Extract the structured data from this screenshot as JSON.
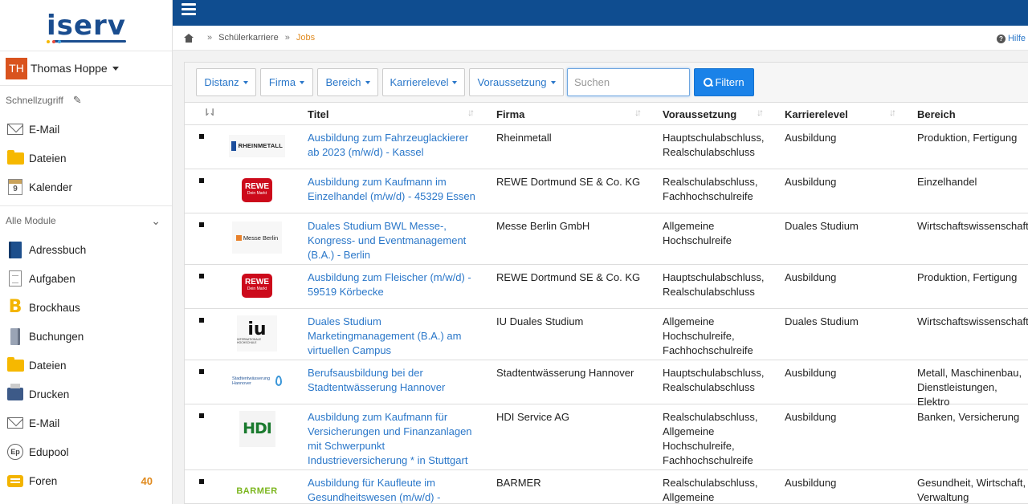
{
  "logo": {
    "text": "iserv"
  },
  "user": {
    "initials": "TH",
    "name": "Thomas Hoppe"
  },
  "sidebar": {
    "quick_access_label": "Schnellzugriff",
    "quick_items": [
      {
        "label": "E-Mail",
        "icon": "mail-icon"
      },
      {
        "label": "Dateien",
        "icon": "folder-icon"
      },
      {
        "label": "Kalender",
        "icon": "calendar-icon",
        "icon_text": "9"
      }
    ],
    "all_modules_label": "Alle Module",
    "modules": [
      {
        "label": "Adressbuch",
        "icon": "addressbook-icon"
      },
      {
        "label": "Aufgaben",
        "icon": "tasks-icon"
      },
      {
        "label": "Brockhaus",
        "icon": "brockhaus-icon",
        "icon_text": "B"
      },
      {
        "label": "Buchungen",
        "icon": "booking-icon"
      },
      {
        "label": "Dateien",
        "icon": "folder-icon"
      },
      {
        "label": "Drucken",
        "icon": "printer-icon"
      },
      {
        "label": "E-Mail",
        "icon": "mail-icon"
      },
      {
        "label": "Edupool",
        "icon": "edupool-icon",
        "icon_text": "Ep"
      },
      {
        "label": "Foren",
        "icon": "forum-icon",
        "badge": "40"
      }
    ]
  },
  "breadcrumb": {
    "items": [
      "Schülerkarriere"
    ],
    "active": "Jobs"
  },
  "help_label": "Hilfe",
  "filters": {
    "buttons": [
      "Distanz",
      "Firma",
      "Bereich",
      "Karrierelevel",
      "Voraussetzung"
    ],
    "search_placeholder": "Suchen",
    "filter_button": "Filtern"
  },
  "table": {
    "columns": [
      "Titel",
      "Firma",
      "Voraussetzung",
      "Karrierelevel",
      "Bereich"
    ],
    "rows": [
      {
        "logo_text": "RHEINMETALL",
        "title": "Ausbildung zum Fahrzeuglackierer ab 2023 (m/w/d) - Kassel",
        "firma": "Rheinmetall",
        "voraussetzung": "Hauptschulabschluss, Realschulabschluss",
        "level": "Ausbildung",
        "bereich": "Produktion, Fertigung"
      },
      {
        "logo_text": "REWE",
        "logo_sub": "Dein Markt",
        "title": "Ausbildung zum Kaufmann im Einzelhandel (m/w/d) - 45329 Essen",
        "firma": "REWE Dortmund SE & Co. KG",
        "voraussetzung": "Realschulabschluss, Fachhochschulreife",
        "level": "Ausbildung",
        "bereich": "Einzelhandel"
      },
      {
        "logo_text": "Messe Berlin",
        "title": "Duales Studium BWL Messe-, Kongress- und Eventmanagement (B.A.) - Berlin",
        "firma": "Messe Berlin GmbH",
        "voraussetzung": "Allgemeine Hochschulreife",
        "level": "Duales Studium",
        "bereich": "Wirtschaftswissenschaften"
      },
      {
        "logo_text": "REWE",
        "logo_sub": "Dein Markt",
        "title": "Ausbildung zum Fleischer (m/w/d) - 59519 Körbecke",
        "firma": "REWE Dortmund SE & Co. KG",
        "voraussetzung": "Hauptschulabschluss, Realschulabschluss",
        "level": "Ausbildung",
        "bereich": "Produktion, Fertigung"
      },
      {
        "logo_text": "iu",
        "logo_sub": "INTERNATIONALE HOCHSCHULE",
        "title": "Duales Studium Marketingmanagement (B.A.) am virtuellen Campus",
        "firma": "IU Duales Studium",
        "voraussetzung": "Allgemeine Hochschulreife, Fachhochschulreife",
        "level": "Duales Studium",
        "bereich": "Wirtschaftswissenschaften"
      },
      {
        "logo_text": "Stadtentwässerung Hannover",
        "title": "Berufsausbildung bei der Stadtentwässerung Hannover",
        "firma": "Stadtentwässerung Hannover",
        "voraussetzung": "Hauptschulabschluss, Realschulabschluss",
        "level": "Ausbildung",
        "bereich": "Metall, Maschinenbau, Dienstleistungen, Elektro"
      },
      {
        "logo_text": "HDI",
        "title": "Ausbildung zum Kaufmann für Versicherungen und Finanzanlagen mit Schwerpunkt Industrieversicherung * in Stuttgart",
        "firma": "HDI Service AG",
        "voraussetzung": "Realschulabschluss, Allgemeine Hochschulreife, Fachhochschulreife",
        "level": "Ausbildung",
        "bereich": "Banken, Versicherung"
      },
      {
        "logo_text": "BARMER",
        "title": "Ausbildung für Kaufleute im Gesundheitswesen (m/w/d) -",
        "firma": "BARMER",
        "voraussetzung": "Realschulabschluss, Allgemeine",
        "level": "Ausbildung",
        "bereich": "Gesundheit, Wirtschaft, Verwaltung"
      }
    ]
  },
  "colors": {
    "topbar": "#0f4d90",
    "link": "#2a77c9",
    "accent": "#e08a1e",
    "avatar": "#d9531e",
    "filter_button": "#1a82e8"
  }
}
